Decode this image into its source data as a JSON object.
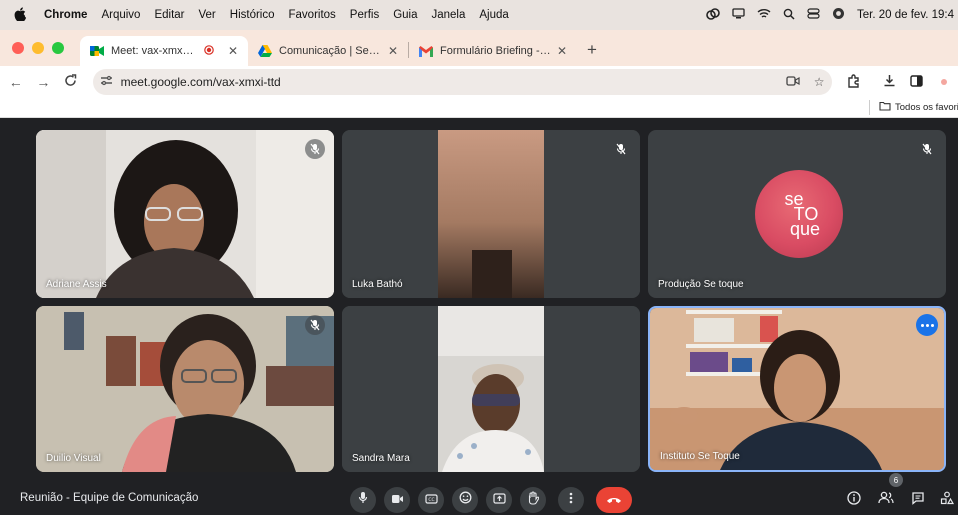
{
  "menubar": {
    "apple": "",
    "items": [
      "Chrome",
      "Arquivo",
      "Editar",
      "Ver",
      "Histórico",
      "Favoritos",
      "Perfis",
      "Guia",
      "Janela",
      "Ajuda"
    ],
    "clock": "Ter. 20 de fev.  19:4"
  },
  "tabs": [
    {
      "title": "Meet: vax-xmxi-ttd",
      "icon": "google-meet-icon"
    },
    {
      "title": "Comunicação | Se Toque - Xi",
      "icon": "google-drive-icon"
    },
    {
      "title": "Formulário Briefing - Xia Prog",
      "icon": "gmail-icon"
    }
  ],
  "address_bar": {
    "url": "meet.google.com/vax-xmxi-ttd"
  },
  "bookmarks": {
    "all_favorites": "Todos os favorit"
  },
  "participants": [
    {
      "name": "Adriane Assis",
      "muted": true
    },
    {
      "name": "Luka Bathó",
      "muted": true
    },
    {
      "name": "Produção Se toque",
      "muted": true,
      "logo_text": [
        "se",
        "TO",
        "que"
      ]
    },
    {
      "name": "Duilio Visual",
      "muted": true
    },
    {
      "name": "Sandra Mara",
      "muted": false
    },
    {
      "name": "Instituto Se Toque",
      "muted": false,
      "speaking": true
    }
  ],
  "meeting": {
    "title": "Reunião - Equipe de Comunicação",
    "people_count": "6"
  },
  "colors": {
    "end_call": "#ea4335",
    "speaking_border": "#8ab4f8",
    "meet_background": "#202124"
  }
}
